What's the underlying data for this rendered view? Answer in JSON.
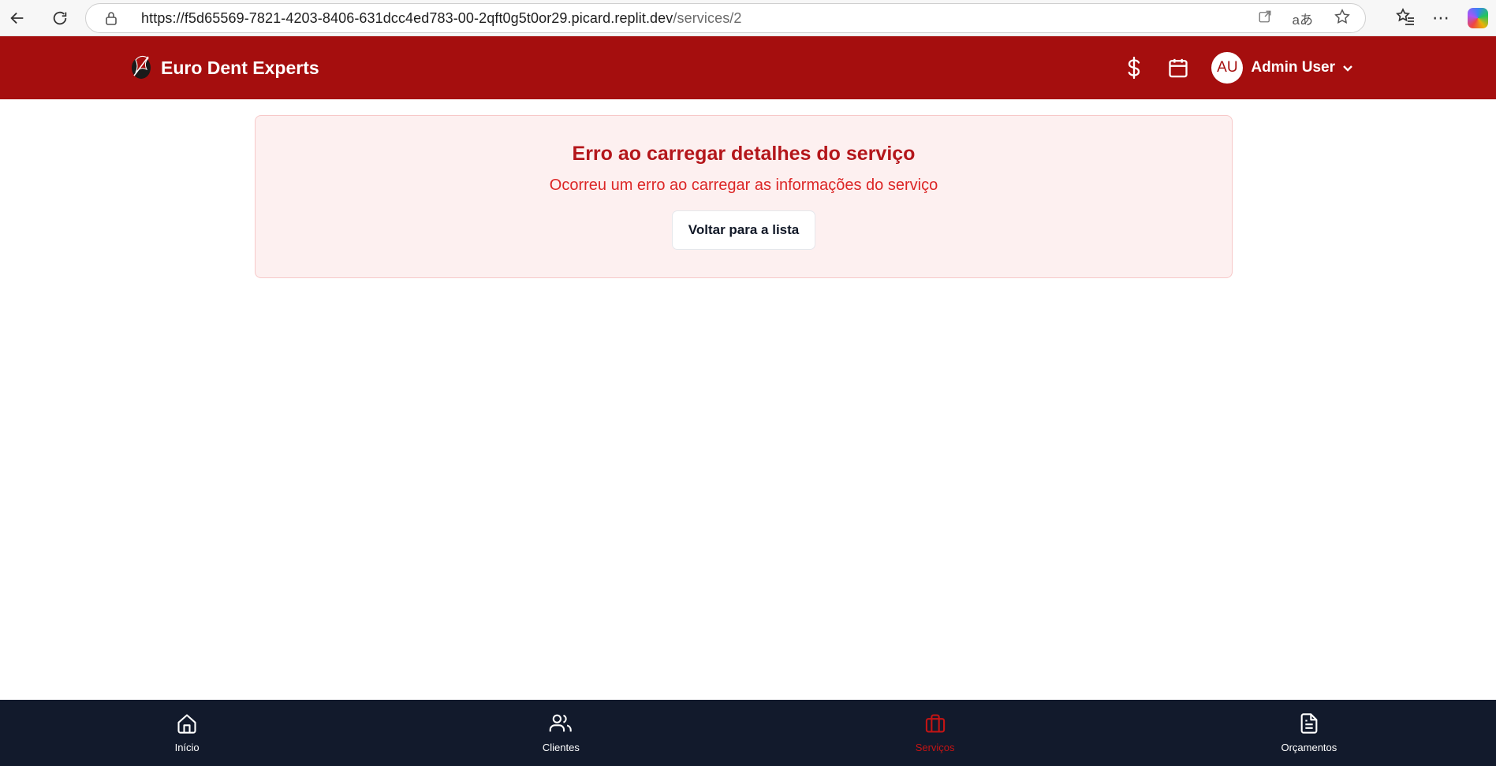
{
  "browser": {
    "url_host": "https://f5d65569-7821-4203-8406-631dcc4ed783-00-2qft0g5t0or29.picard.replit.dev",
    "url_path": "/services/2"
  },
  "header": {
    "brand_name": "Euro Dent Experts",
    "avatar_initials": "AU",
    "user_name": "Admin User",
    "icons": [
      "dollar-icon",
      "calendar-icon",
      "chevron-down-icon"
    ]
  },
  "error": {
    "title": "Erro ao carregar detalhes do serviço",
    "message": "Ocorreu um erro ao carregar as informações do serviço",
    "button_label": "Voltar para a lista"
  },
  "bottom_nav": {
    "items": [
      {
        "label": "Início",
        "icon": "home-icon",
        "active": false
      },
      {
        "label": "Clientes",
        "icon": "users-icon",
        "active": false
      },
      {
        "label": "Serviços",
        "icon": "briefcase-icon",
        "active": true
      },
      {
        "label": "Orçamentos",
        "icon": "document-icon",
        "active": false
      }
    ]
  },
  "colors": {
    "header_bg": "#a50e0e",
    "error_title": "#b4161b",
    "error_bg": "#fdf0f0",
    "bottom_nav_bg": "#121a2c",
    "active_nav": "#c41414"
  }
}
